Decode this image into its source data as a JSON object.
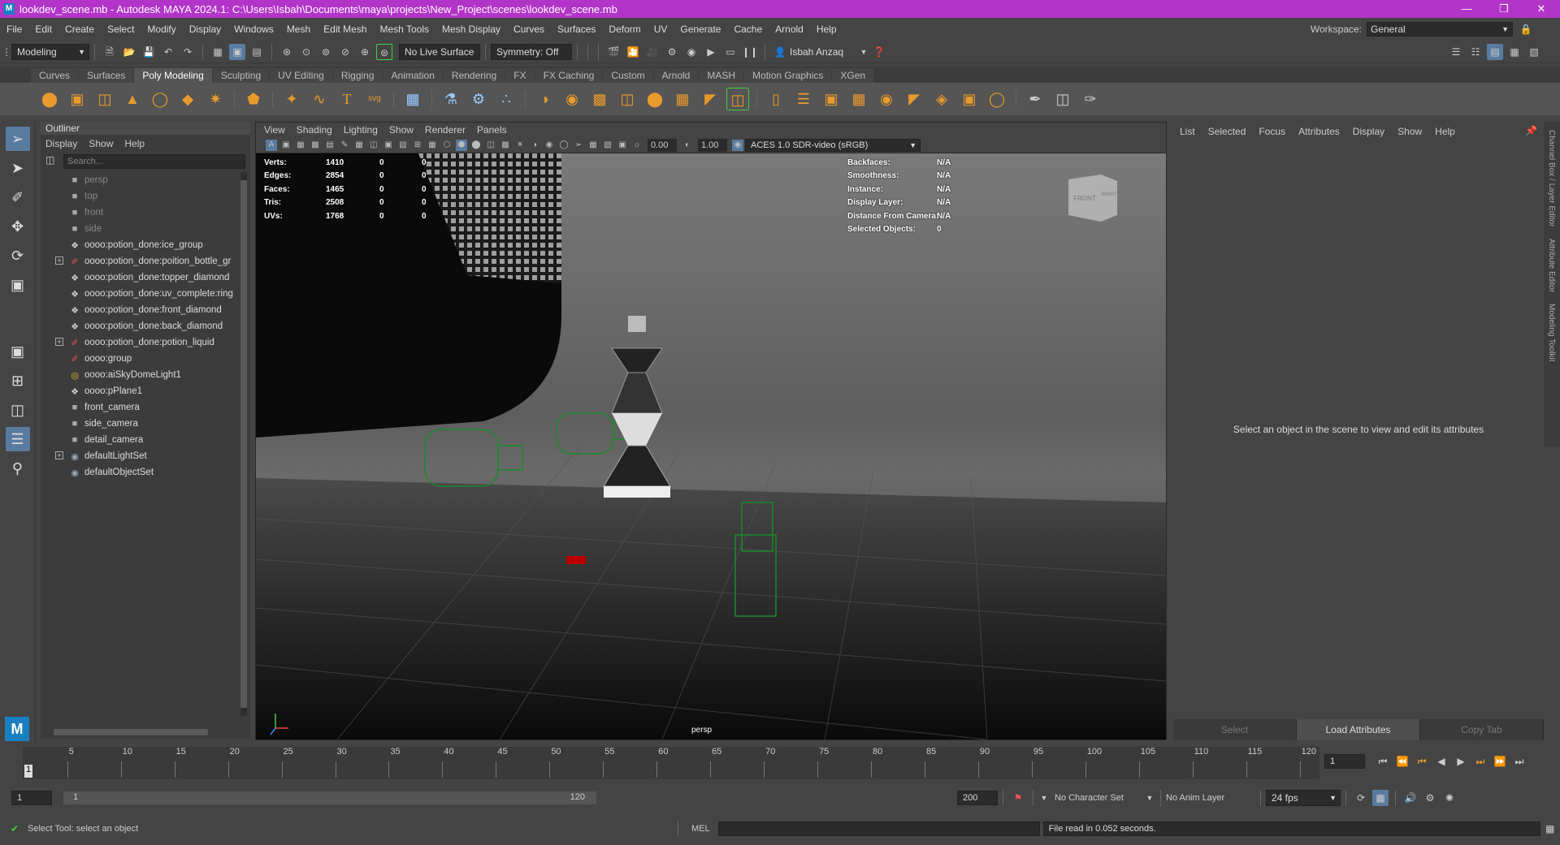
{
  "window": {
    "title": "lookdev_scene.mb - Autodesk MAYA 2024.1: C:\\Users\\Isbah\\Documents\\maya\\projects\\New_Project\\scenes\\lookdev_scene.mb",
    "logo": "M"
  },
  "menubar": [
    "File",
    "Edit",
    "Create",
    "Select",
    "Modify",
    "Display",
    "Windows",
    "Mesh",
    "Edit Mesh",
    "Mesh Tools",
    "Mesh Display",
    "Curves",
    "Surfaces",
    "Deform",
    "UV",
    "Generate",
    "Cache",
    "Arnold",
    "Help"
  ],
  "workspace": {
    "label": "Workspace:",
    "value": "General"
  },
  "statusline": {
    "mode": "Modeling",
    "live_surface": "No Live Surface",
    "symmetry": "Symmetry: Off",
    "user": "Isbah Anzaq"
  },
  "shelf_tabs": [
    "Curves",
    "Surfaces",
    "Poly Modeling",
    "Sculpting",
    "UV Editing",
    "Rigging",
    "Animation",
    "Rendering",
    "FX",
    "FX Caching",
    "Custom",
    "Arnold",
    "MASH",
    "Motion Graphics",
    "XGen"
  ],
  "shelf_active": "Poly Modeling",
  "outliner": {
    "title": "Outliner",
    "menu": [
      "Display",
      "Show",
      "Help"
    ],
    "search_placeholder": "Search...",
    "items": [
      {
        "label": "persp",
        "icon": "camera-icon",
        "dim": true,
        "expand": ""
      },
      {
        "label": "top",
        "icon": "camera-icon",
        "dim": true,
        "expand": ""
      },
      {
        "label": "front",
        "icon": "camera-icon",
        "dim": true,
        "expand": ""
      },
      {
        "label": "side",
        "icon": "camera-icon",
        "dim": true,
        "expand": ""
      },
      {
        "label": "oooo:potion_done:ice_group",
        "icon": "transform-icon",
        "dim": false,
        "expand": ""
      },
      {
        "label": "oooo:potion_done:poition_bottle_gr",
        "icon": "group-icon",
        "dim": false,
        "expand": "+"
      },
      {
        "label": "oooo:potion_done:topper_diamond",
        "icon": "transform-icon",
        "dim": false,
        "expand": ""
      },
      {
        "label": "oooo:potion_done:uv_complete:ring",
        "icon": "transform-icon",
        "dim": false,
        "expand": ""
      },
      {
        "label": "oooo:potion_done:front_diamond",
        "icon": "transform-icon",
        "dim": false,
        "expand": ""
      },
      {
        "label": "oooo:potion_done:back_diamond",
        "icon": "transform-icon",
        "dim": false,
        "expand": ""
      },
      {
        "label": "oooo:potion_done:potion_liquid",
        "icon": "group-icon",
        "dim": false,
        "expand": "+"
      },
      {
        "label": "oooo:group",
        "icon": "group-icon",
        "dim": false,
        "expand": ""
      },
      {
        "label": "oooo:aiSkyDomeLight1",
        "icon": "light-icon",
        "dim": false,
        "expand": ""
      },
      {
        "label": "oooo:pPlane1",
        "icon": "transform-icon",
        "dim": false,
        "expand": ""
      },
      {
        "label": "front_camera",
        "icon": "camera-icon",
        "dim": false,
        "expand": ""
      },
      {
        "label": "side_camera",
        "icon": "camera-icon",
        "dim": false,
        "expand": ""
      },
      {
        "label": "detail_camera",
        "icon": "camera-icon",
        "dim": false,
        "expand": ""
      },
      {
        "label": "defaultLightSet",
        "icon": "set-icon",
        "dim": false,
        "expand": "+"
      },
      {
        "label": "defaultObjectSet",
        "icon": "set-icon",
        "dim": false,
        "expand": ""
      }
    ]
  },
  "viewport": {
    "menu": [
      "View",
      "Shading",
      "Lighting",
      "Show",
      "Renderer",
      "Panels"
    ],
    "exposure": "0.00",
    "gamma": "1.00",
    "colorspace": "ACES 1.0 SDR-video (sRGB)",
    "camera_label": "persp",
    "hud_left": [
      {
        "k": "Verts:",
        "a": "1410",
        "b": "0",
        "c": "0"
      },
      {
        "k": "Edges:",
        "a": "2854",
        "b": "0",
        "c": "0"
      },
      {
        "k": "Faces:",
        "a": "1465",
        "b": "0",
        "c": "0"
      },
      {
        "k": "Tris:",
        "a": "2508",
        "b": "0",
        "c": "0"
      },
      {
        "k": "UVs:",
        "a": "1768",
        "b": "0",
        "c": "0"
      }
    ],
    "hud_right": [
      {
        "k": "Backfaces:",
        "v": "N/A"
      },
      {
        "k": "Smoothness:",
        "v": "N/A"
      },
      {
        "k": "Instance:",
        "v": "N/A"
      },
      {
        "k": "Display Layer:",
        "v": "N/A"
      },
      {
        "k": "Distance From Camera:",
        "v": "N/A"
      },
      {
        "k": "Selected Objects:",
        "v": "0"
      }
    ],
    "viewcube_front": "FRONT",
    "viewcube_right": "RIGHT"
  },
  "channelbox": {
    "menu": [
      "List",
      "Selected",
      "Focus",
      "Attributes",
      "Display",
      "Show",
      "Help"
    ],
    "message": "Select an object in the scene to view and edit its attributes",
    "buttons": [
      "Select",
      "Load Attributes",
      "Copy Tab"
    ],
    "side_tabs": [
      "Channel Box / Layer Editor",
      "Attribute Editor",
      "Modeling Toolkit"
    ]
  },
  "timeline": {
    "ticks": [
      "5",
      "10",
      "15",
      "20",
      "25",
      "30",
      "35",
      "40",
      "45",
      "50",
      "55",
      "60",
      "65",
      "70",
      "75",
      "80",
      "85",
      "90",
      "95",
      "100",
      "105",
      "110",
      "115",
      "120"
    ],
    "current": "1",
    "current_field": "1"
  },
  "range": {
    "start": "1",
    "range_start": "1",
    "range_end": "120",
    "end": "200",
    "character_set": "No Character Set",
    "anim_layer": "No Anim Layer",
    "fps": "24 fps"
  },
  "cmdline": {
    "help": "Select Tool: select an object",
    "lang": "MEL",
    "result": "File read in  0.052 seconds."
  }
}
